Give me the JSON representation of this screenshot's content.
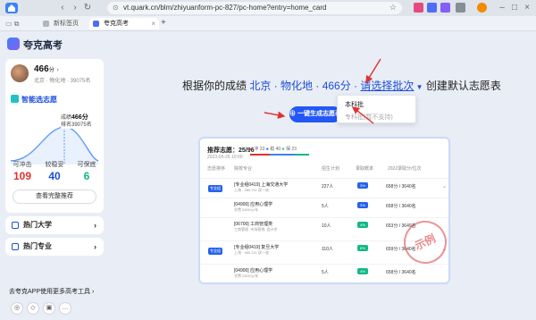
{
  "browser": {
    "url": "vt.quark.cn/blm/zhiyuanform-pc-827/pc-home?entry=home_card",
    "tabs": [
      {
        "label": "新标签页"
      },
      {
        "label": "夸克高考"
      }
    ]
  },
  "app": {
    "name": "夸克高考"
  },
  "profile": {
    "score": "466",
    "score_unit": "分",
    "sub": "北京 · 物化地 · 39075名"
  },
  "smart": {
    "title": "智能选志愿",
    "tip_label1": "成绩",
    "tip_score": "466分",
    "tip_rank": "排名39075名",
    "stats": [
      {
        "label": "可冲击",
        "value": "109",
        "color": "#e03131"
      },
      {
        "label": "较稳妥",
        "value": "40",
        "color": "#1d4ed8"
      },
      {
        "label": "可保底",
        "value": "6",
        "color": "#12b886"
      }
    ],
    "button": "查看完整推荐"
  },
  "side_items": [
    {
      "label": "热门大学"
    },
    {
      "label": "热门专业"
    }
  ],
  "bottom": {
    "text": "去夸克APP使用更多高考工具"
  },
  "main": {
    "headline_pre": "根据你的成绩",
    "headline_info": "北京 · 物化地 · 466分 ·",
    "headline_select": "请选择批次",
    "headline_post": "创建默认志愿表",
    "cta": "一键生成志愿表",
    "dropdown": [
      "本科批",
      "专科批(暂不支持)"
    ]
  },
  "preview": {
    "title": "推荐志愿：25/96",
    "legend": [
      "冲 33",
      "稳 40",
      "保 23"
    ],
    "date": "2023-06-26 10:00",
    "cols": [
      "志愿排序",
      "院校专业",
      "招生计划",
      "录取概率",
      "2022录取分/位次"
    ],
    "rows": [
      {
        "tag": "专业组",
        "title": "[专业组0419] 上海交通大学",
        "sub": "上海 · 985 211 双一流",
        "n": "227人",
        "pct": "3%",
        "pct_color": "#2563eb",
        "rank": "658分 / 3640名"
      },
      {
        "tag": "",
        "title": "[04900] 应用心理学",
        "sub": "学费 5300元/年",
        "n": "5人",
        "pct": "3%",
        "pct_color": "#2563eb",
        "rank": "658分 / 3640名"
      },
      {
        "tag": "",
        "title": "[06700] 工商管理类",
        "sub": "工商管理, 市场营销, 会计学",
        "n": "10人",
        "pct": "4%",
        "pct_color": "#12b886",
        "rank": "653分 / 3649名"
      },
      {
        "tag": "专业组",
        "title": "[专业组0419] 复旦大学",
        "sub": "上海 · 985 211 双一流",
        "n": "110人",
        "pct": "6%",
        "pct_color": "#12b886",
        "rank": "659分 / 3640名"
      },
      {
        "tag": "",
        "title": "[04900] 应用心理学",
        "sub": "学费 5300元/年",
        "n": "5人",
        "pct": "4%",
        "pct_color": "#12b886",
        "rank": "658分 / 3640名"
      }
    ],
    "stamp": "示例"
  }
}
